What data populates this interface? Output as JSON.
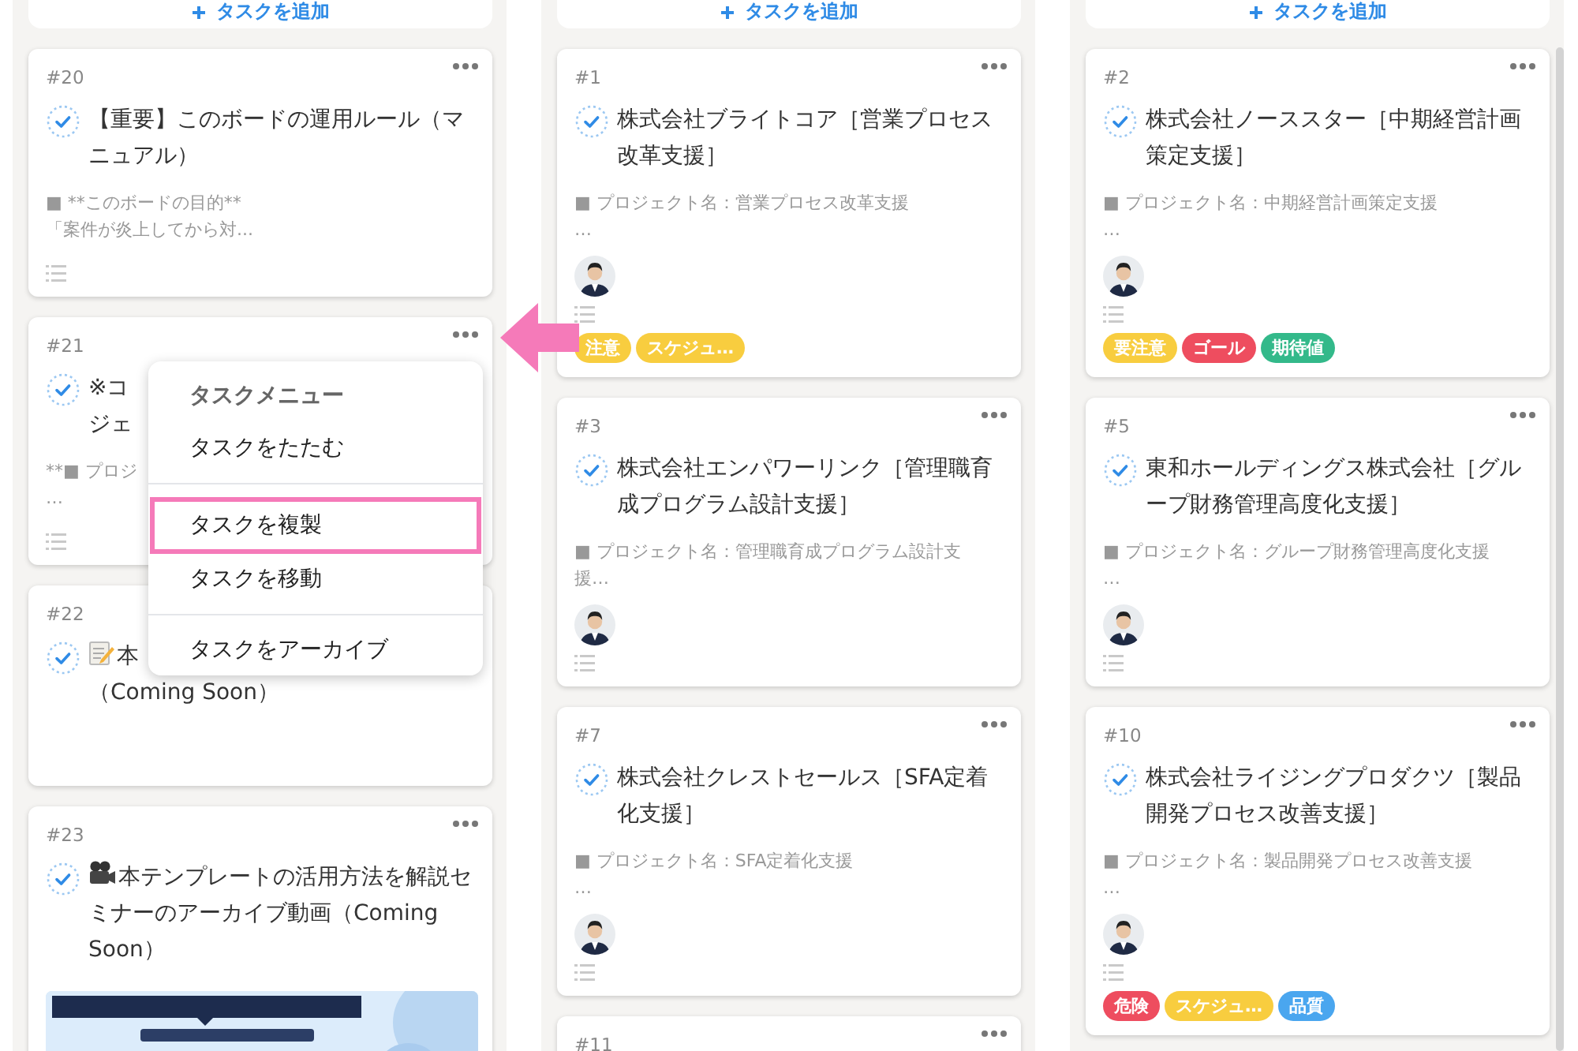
{
  "columns": [
    {
      "add_button": "タスクを追加",
      "cards": [
        {
          "id": "#20",
          "more_button": true,
          "title": "【重要】このボードの運用ルール（マニュアル）",
          "description": [
            "■ **このボードの目的**",
            "「案件が炎上してから対..."
          ],
          "checklist": true
        },
        {
          "id": "#21",
          "more_button": true,
          "title_lines": [
            "※コ",
            "ジェ"
          ],
          "description": [
            "**■ プロジ",
            "…"
          ],
          "checklist": true
        },
        {
          "id": "#22",
          "title_icon": {
            "kind": "memo"
          },
          "title_lines": [
            "本",
            "（Coming Soon）"
          ]
        },
        {
          "id": "#23",
          "more_button": true,
          "title_icon": {
            "kind": "camera"
          },
          "title": "本テンプレートの活用方法を解説セミナーのアーカイブ動画（Coming Soon）"
        }
      ]
    },
    {
      "add_button": "タスクを追加",
      "cards": [
        {
          "id": "#1",
          "more_button": true,
          "title": "株式会社ブライトコア［営業プロセス改革支援］",
          "description": [
            "■ プロジェクト名：営業プロセス改革支援",
            "…"
          ],
          "avatar": true,
          "checklist": true,
          "tags": [
            {
              "label": "注意",
              "color": "#f8cd3f"
            },
            {
              "label": "スケジュ…",
              "color": "#f8cd3f"
            }
          ]
        },
        {
          "id": "#3",
          "more_button": true,
          "title": "株式会社エンパワーリンク［管理職育成プログラム設計支援］",
          "description": [
            "■ プロジェクト名：管理職育成プログラム設計支",
            "援…"
          ],
          "avatar": true,
          "checklist": true
        },
        {
          "id": "#7",
          "more_button": true,
          "title": "株式会社クレストセールス［SFA定着化支援］",
          "description": [
            "■ プロジェクト名：SFA定着化支援",
            "…"
          ],
          "avatar": true,
          "checklist": true
        },
        {
          "id": "#11",
          "more_button": true
        }
      ]
    },
    {
      "add_button": "タスクを追加",
      "scrollbar": true,
      "cards": [
        {
          "id": "#2",
          "more_button": true,
          "title": "株式会社ノーススター［中期経営計画策定支援］",
          "description": [
            "■ プロジェクト名：中期経営計画策定支援",
            "…"
          ],
          "avatar": true,
          "checklist": true,
          "tags": [
            {
              "label": "要注意",
              "color": "#f8cd3f"
            },
            {
              "label": "ゴール",
              "color": "#ee4d5f"
            },
            {
              "label": "期待値",
              "color": "#33b98a"
            }
          ]
        },
        {
          "id": "#5",
          "more_button": true,
          "title": "東和ホールディングス株式会社［グループ財務管理高度化支援］",
          "description": [
            "■ プロジェクト名：グループ財務管理高度化支援",
            "…"
          ],
          "avatar": true,
          "checklist": true
        },
        {
          "id": "#10",
          "more_button": true,
          "title": "株式会社ライジングプロダクツ［製品開発プロセス改善支援］",
          "description": [
            "■ プロジェクト名：製品開発プロセス改善支援",
            "…"
          ],
          "avatar": true,
          "checklist": true,
          "tags": [
            {
              "label": "危険",
              "color": "#ee4d5f"
            },
            {
              "label": "スケジュ…",
              "color": "#f8cd3f"
            },
            {
              "label": "品質",
              "color": "#4aa6ef"
            }
          ]
        }
      ]
    }
  ],
  "menu": {
    "title": "タスクメニュー",
    "groups": [
      [
        {
          "label": "タスクをたたむ",
          "highlighted": false
        }
      ],
      [
        {
          "label": "タスクを複製",
          "highlighted": true
        },
        {
          "label": "タスクを移動",
          "highlighted": false
        }
      ],
      [
        {
          "label": "タスクをアーカイブ",
          "highlighted": false
        }
      ]
    ]
  },
  "annotations": [
    {
      "kind": "arrow"
    }
  ]
}
